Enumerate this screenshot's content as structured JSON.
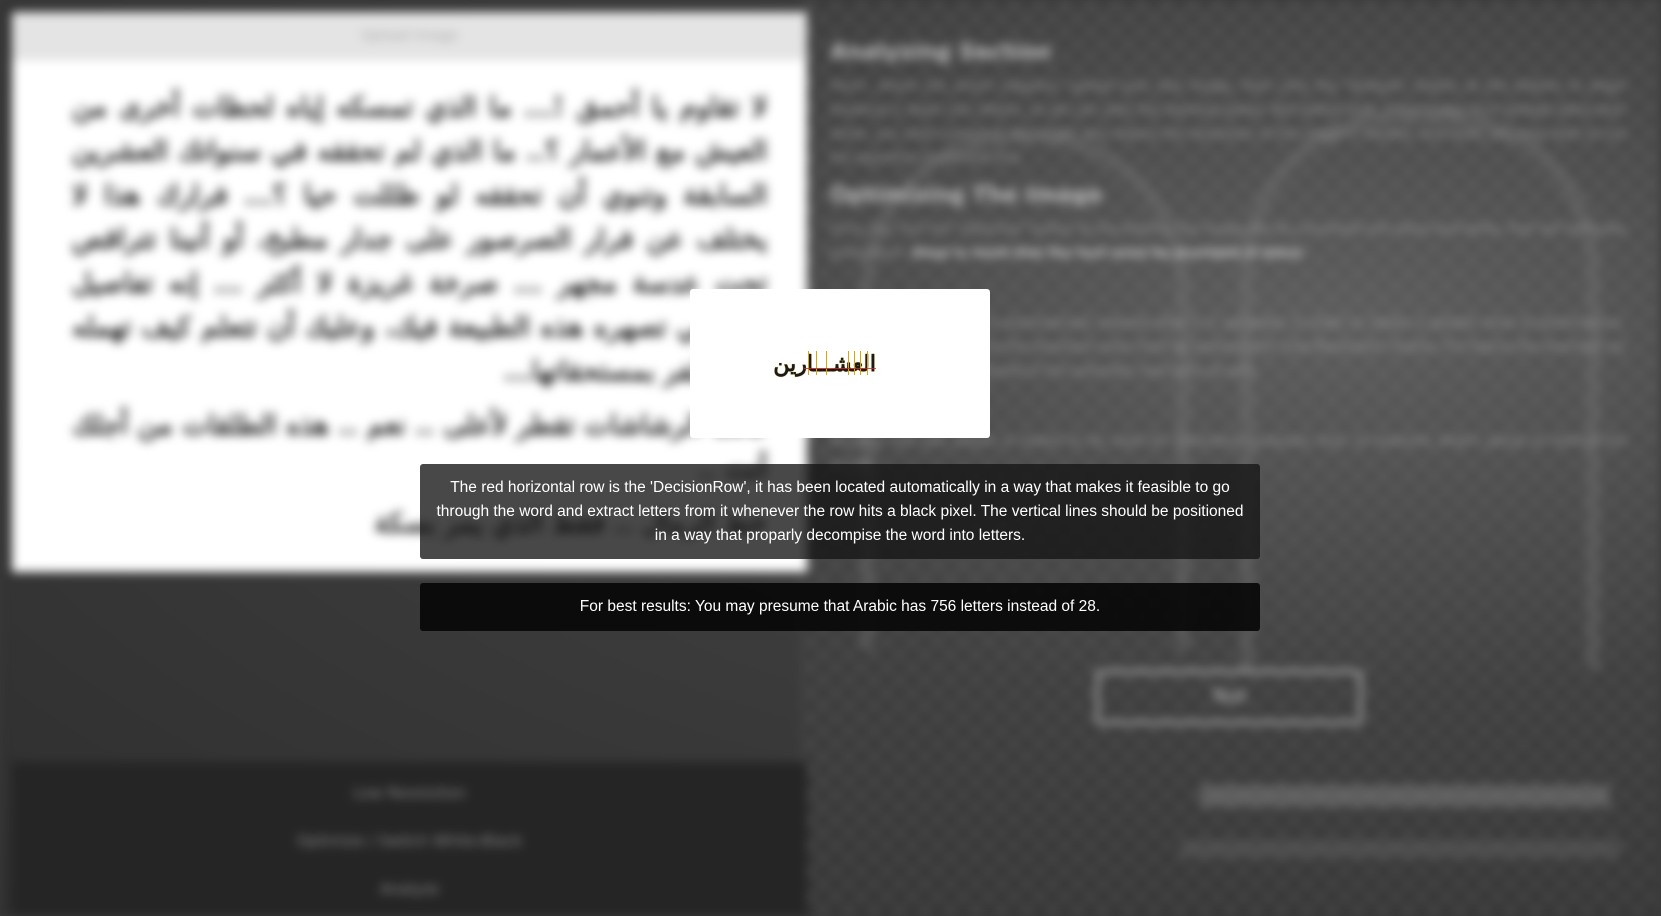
{
  "upload_panel": {
    "header": "Upload Image",
    "arabic_paragraphs": [
      "لا تقاوم يا أحمق !... ما الذي تمسكه إياه لحظات أخرى من العيش مع الأعمار ؟.. ما الذي لم تحققه في سنواتك العشرين السابقة وتنوي أن تحققه لو ظللت حيا ؟... فرارك هذا لا يختلف عن فرار الصرصور على جدار مطبخ، أو أنينا تتراقص تحت عدسة مجهر ... صرخة غريزة لا أكثر ... إنه تفاصيل التعاسي تصهره هذه الطبيعة فيك، وعليك أن تتعلم كيف تهمله كي تظفر بمستحقاتها...",
      "كانت الرشاشات تقطر لأعلى .. نعم .. هذه الطلقات من أجلك أنت ..",
      "خط الرمال .. فقط الذي يمر بسكة"
    ]
  },
  "bottom_menu": {
    "low_resolution": "Low Resolution",
    "optimize": "Optimize / Switch White-Black",
    "analyze": "Analyze"
  },
  "info": {
    "analyzing_title": "Analyzing Section",
    "analyzing_body": "Here!, where the action happens: upload your text image, then click the \"Analyze\" button at the bottom to begin breaking it down into letters, so we can start the learning phase. But before that, if the image isn't already black-and-white, you shall convert it. You might also reduce the resolution of the image if needed, and lastly you may wish to run the algorithm to the text first.",
    "optimizing_title": "Optimizing The Image",
    "optimizing_body": "Once you click the \"Optimize\" button at the bottom, the image will be converted into black-and-white, that will eliminate pixelization.",
    "optimizing_bold": "Keep in mind that the text must be provided in black.",
    "resolution_body": "The image's resolution is automatically lowered after it is uploaded, in order to obtain a greater level of performance. However, you may reduce the resolution even more by pressing the \"Low Resolution\" button, it'll reduce the resolution by half, which is usually required to the automatic execution as well.",
    "test_body": "Actually, the test button is meant to be used for illustration purposes only, to examine what's going on behind the scenes.",
    "test_button": "Test"
  },
  "overlay": {
    "word": "العشـــارين",
    "explanation": "The red horizontal row is the 'DecisionRow', it has been located automatically in a way that makes it feasible to go through the word and extract letters from it whenever the row hits a black pixel. The vertical lines should be positioned in a way that proparly decompise the word into letters.",
    "tip": "For best results: You may presume that Arabic has 756 letters instead of 28."
  },
  "colors": {
    "decision_row": "#d22828",
    "split_line": "#d8a800"
  }
}
